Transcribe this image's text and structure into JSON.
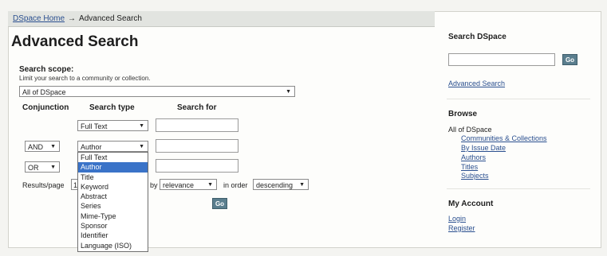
{
  "breadcrumb": {
    "home": "DSpace Home",
    "arrow": "→",
    "current": "Advanced Search"
  },
  "page_title": "Advanced Search",
  "scope": {
    "title": "Search scope:",
    "hint": "Limit your search to a community or collection.",
    "selected": "All of DSpace"
  },
  "columns": {
    "conjunction": "Conjunction",
    "search_type": "Search type",
    "search_for": "Search for"
  },
  "rows": [
    {
      "type": "Full Text",
      "value": ""
    },
    {
      "conjunction": "AND",
      "type": "Author",
      "value": ""
    },
    {
      "conjunction": "OR",
      "value": ""
    }
  ],
  "type_options": [
    "Full Text",
    "Author",
    "Title",
    "Keyword",
    "Abstract",
    "Series",
    "Mime-Type",
    "Sponsor",
    "Identifier",
    "Language (ISO)"
  ],
  "highlighted_option": "Author",
  "results": {
    "label": "Results/page",
    "value_partial": "1",
    "sort_label_partial": "by",
    "sort_value": "relevance",
    "order_label": "in order",
    "order_value": "descending"
  },
  "go_label": "Go",
  "sidebar": {
    "search_title": "Search DSpace",
    "search_value": "",
    "go_label": "Go",
    "advanced_link": "Advanced Search",
    "browse_title": "Browse",
    "browse_scope": "All of DSpace",
    "browse_links": [
      "Communities & Collections",
      "By Issue Date",
      "Authors",
      "Titles",
      "Subjects"
    ],
    "account_title": "My Account",
    "account_links": [
      "Login",
      "Register"
    ]
  },
  "colors": {
    "link": "#2a4f8f",
    "highlight": "#3a73c8",
    "button": "#5a7e8e"
  }
}
